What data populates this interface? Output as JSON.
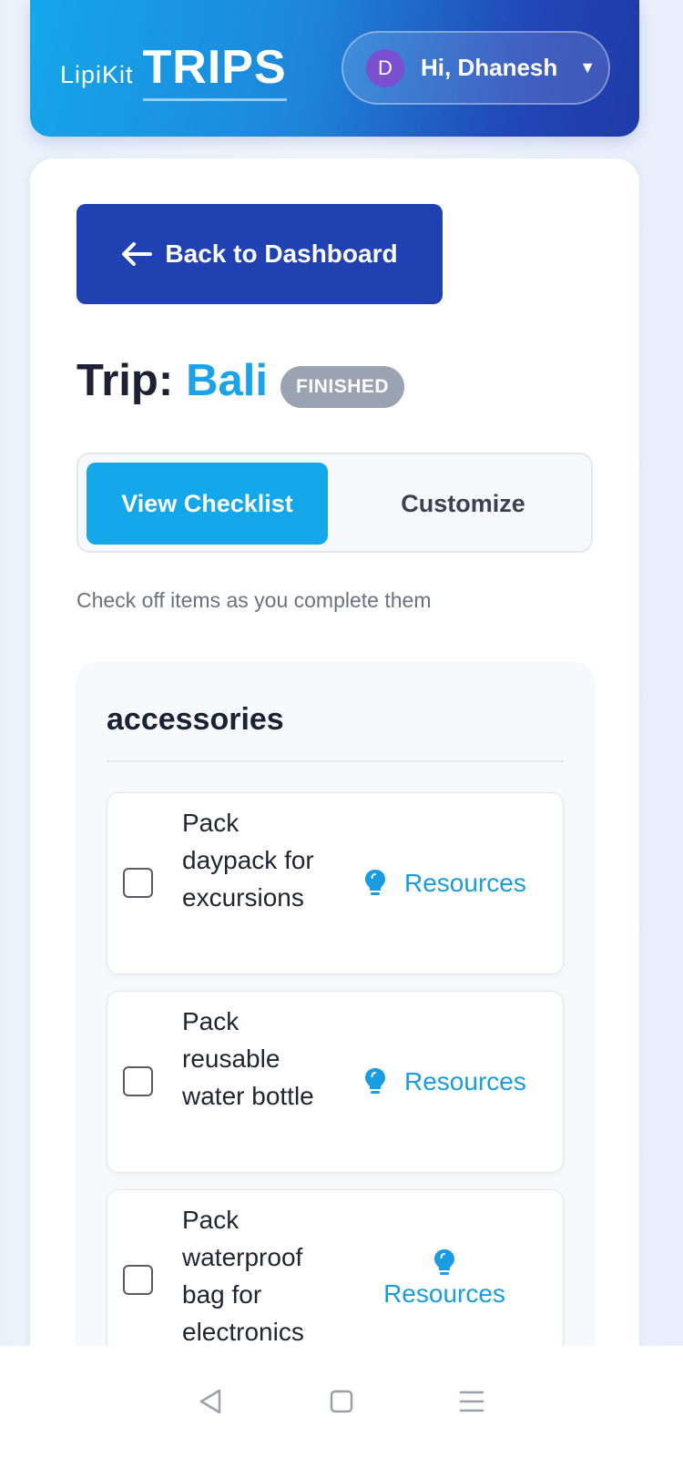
{
  "header": {
    "brand_small": "LipiKit",
    "brand_big": "TRIPS",
    "user_initial": "D",
    "greeting": "Hi, Dhanesh",
    "caret": "▼"
  },
  "back_button": {
    "label": "Back to Dashboard"
  },
  "trip": {
    "prefix": "Trip:",
    "name": "Bali",
    "status": "FINISHED"
  },
  "tabs": [
    {
      "label": "View Checklist",
      "active": true
    },
    {
      "label": "Customize",
      "active": false
    }
  ],
  "hint": "Check off items as you complete them",
  "section": {
    "title": "accessories",
    "items": [
      {
        "label": "Pack daypack for excursions",
        "checked": false,
        "resources_label": "Resources"
      },
      {
        "label": "Pack reusable water bottle",
        "checked": false,
        "resources_label": "Resources"
      },
      {
        "label": "Pack waterproof bag for electronics",
        "checked": false,
        "resources_label": "Resources"
      }
    ]
  },
  "colors": {
    "primary_blue": "#14a7ea",
    "dark_blue": "#2041b1",
    "badge_gray": "#9aa3b1",
    "avatar_purple": "#7a4fd0"
  },
  "icons": {
    "back": "arrow-left-icon",
    "resources": "lightbulb-icon",
    "nav_back": "triangle-back-icon",
    "nav_home": "square-home-icon",
    "nav_menu": "menu-icon"
  }
}
